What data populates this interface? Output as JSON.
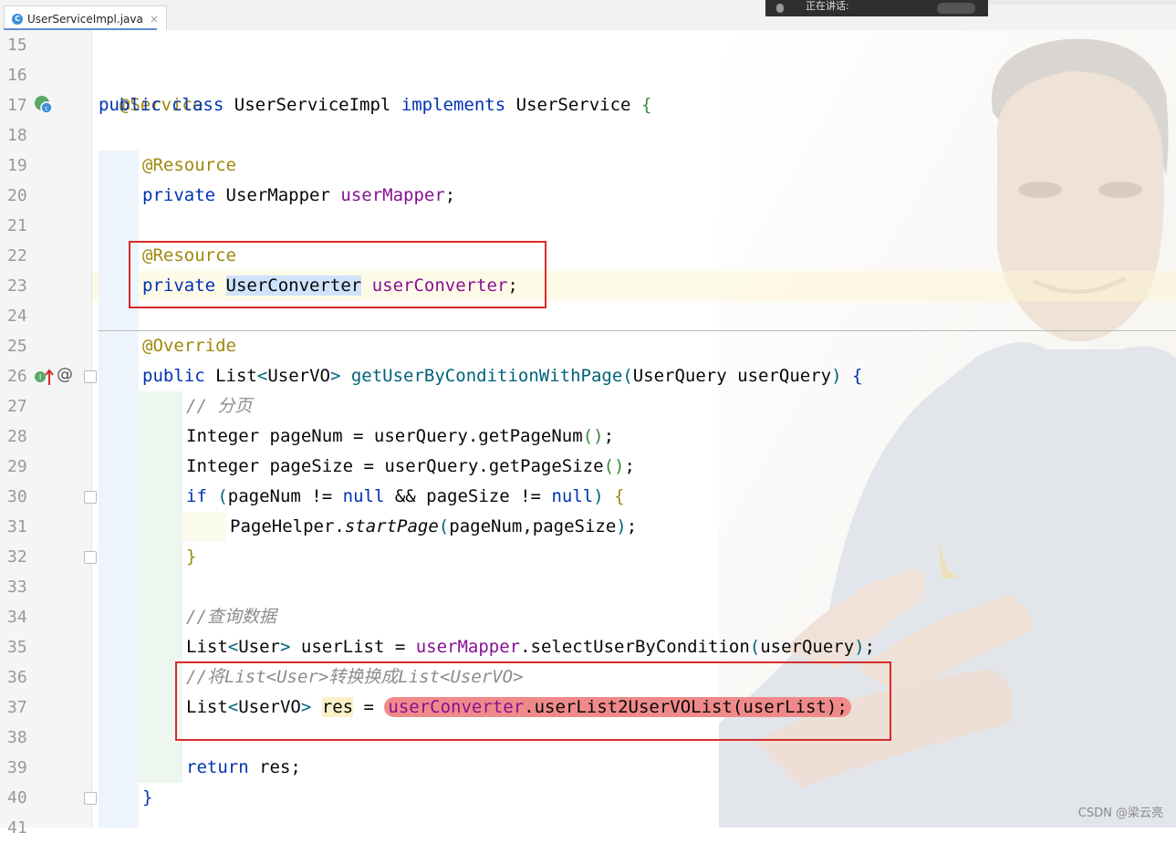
{
  "tab": {
    "title": "UserServiceImpl.java",
    "icon": "java-class-icon",
    "icon_letter": "C"
  },
  "overlay": {
    "label": "正在讲话:"
  },
  "line_numbers": [
    "15",
    "16",
    "17",
    "18",
    "19",
    "20",
    "21",
    "22",
    "23",
    "24",
    "25",
    "26",
    "27",
    "28",
    "29",
    "30",
    "31",
    "32",
    "33",
    "34",
    "35",
    "36",
    "37",
    "38",
    "39",
    "40",
    "41"
  ],
  "code": {
    "l16": {
      "ann": "@Service"
    },
    "l17": {
      "kw1": "public",
      "kw2": "class",
      "name": "UserServiceImpl",
      "kw3": "implements",
      "iface": "UserService",
      "brace": "{"
    },
    "l19": {
      "ann": "@Resource"
    },
    "l20": {
      "kw": "private",
      "type": "UserMapper",
      "field": "userMapper",
      "semi": ";"
    },
    "l22": {
      "ann": "@Resource"
    },
    "l23": {
      "kw": "private",
      "type": "UserConverter",
      "field": "userConverter",
      "semi": ";"
    },
    "l25": {
      "ann": "@Override"
    },
    "l26": {
      "kw": "public",
      "ret1": "List",
      "lt": "<",
      "ret2": "UserVO",
      "gt": ">",
      "method": "getUserByConditionWithPage",
      "open": "(",
      "ptype": "UserQuery",
      "pname": "userQuery",
      "close": ")",
      "brace": "{"
    },
    "l27": {
      "comment": "// 分页"
    },
    "l28": {
      "text": "Integer pageNum = userQuery.getPageNum",
      "paren": "()",
      "semi": ";"
    },
    "l29": {
      "text": "Integer pageSize = userQuery.getPageSize",
      "paren": "()",
      "semi": ";"
    },
    "l30": {
      "kw": "if",
      "open": "(",
      "mid1": "pageNum != ",
      "null1": "null",
      "mid2": " && pageSize != ",
      "null2": "null",
      "close": ")",
      "brace": "{"
    },
    "l31": {
      "cls": "PageHelper.",
      "method": "startPage",
      "open": "(",
      "args": "pageNum,pageSize",
      "close": ")",
      "semi": ";"
    },
    "l32": {
      "brace": "}"
    },
    "l34": {
      "comment": "//查询数据"
    },
    "l35": {
      "t1": "List",
      "lt": "<",
      "t2": "User",
      "gt": ">",
      "var": " userList = ",
      "field": "userMapper",
      "call": ".selectUserByCondition",
      "open": "(",
      "arg": "userQuery",
      "close": ")",
      "semi": ";"
    },
    "l36": {
      "comment": "//将List<User>转换换成List<UserVO>"
    },
    "l37": {
      "t1": "List",
      "lt": "<",
      "t2": "UserVO",
      "gt": ">",
      "var": "res",
      "eq": " = ",
      "field": "userConverter",
      "call": ".userList2UserVOList",
      "open": "(",
      "arg": "userList",
      "close": ")",
      "semi": ";"
    },
    "l39": {
      "kw": "return",
      "rest": " res;"
    },
    "l40": {
      "brace": "}"
    }
  },
  "colors": {
    "keyword": "#0033b3",
    "annotation": "#9e880d",
    "field": "#871094",
    "method": "#00627a",
    "comment": "#8c8c8c",
    "highlight_box": "#d72b2b"
  },
  "watermark": "CSDN @梁云亮"
}
